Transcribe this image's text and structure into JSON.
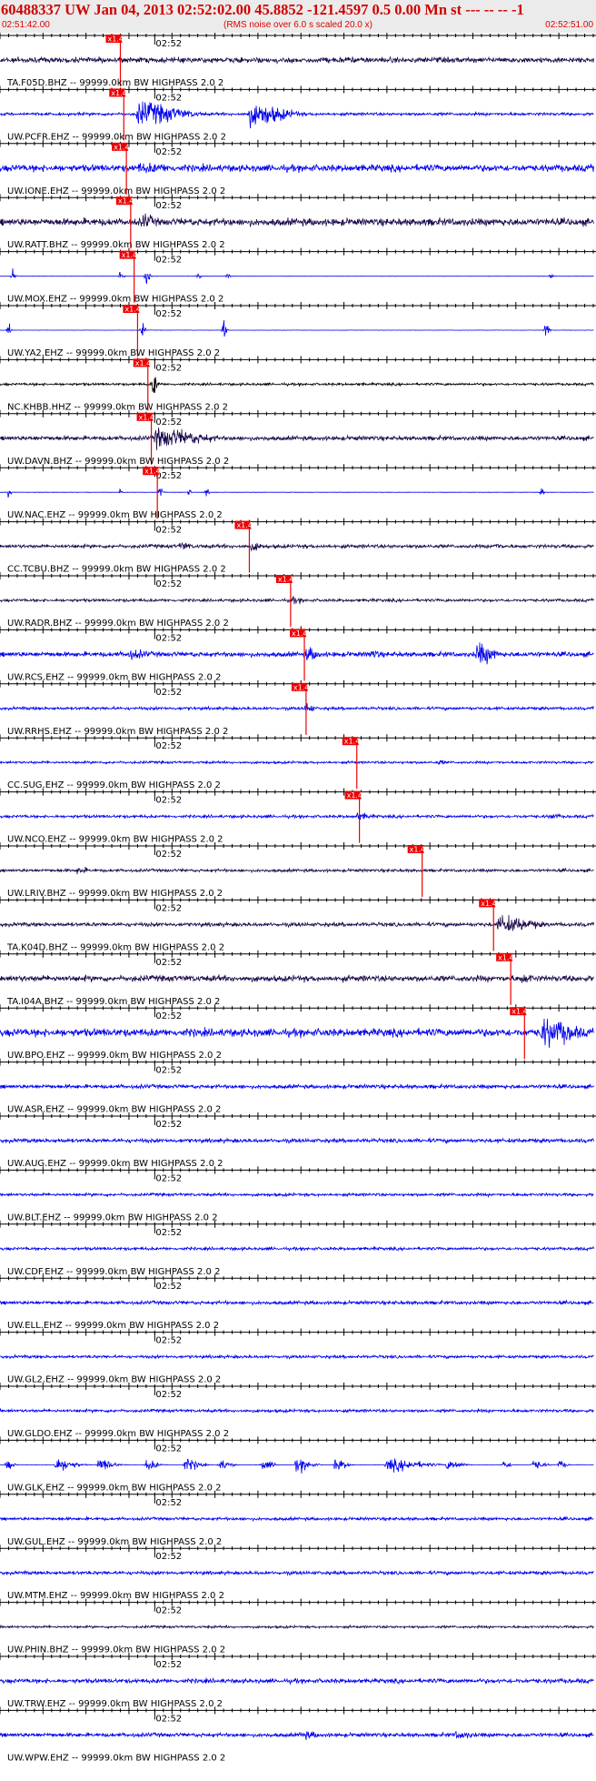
{
  "header": {
    "title": "60488337 UW Jan 04, 2013 02:52:02.00   45.8852 -121.4597  0.5 0.00 Mn st --- -- --   -1",
    "start_time": "02:51:42.00",
    "note": "(RMS noise over 6.0 s scaled 20.0 x)",
    "end_time": "02:52:51.00"
  },
  "chart_data": {
    "type": "line",
    "title": "60488337 UW Jan 04, 2013 02:52:02.00   45.8852 -121.4597  0.5 0.00 Mn st --- -- --   -1",
    "x_range_seconds": [
      0,
      69
    ],
    "minute_marker_label": "02:52",
    "minute_marker_second": 18,
    "pick_label": "x1.4",
    "colors": {
      "dark_trace": "#1c0a4c",
      "blue_trace": "#0000ee",
      "black_trace": "#000000",
      "pick": "#ee0000"
    },
    "traces": [
      {
        "label": "TA.F05D.BHZ -- 99999.0km BW  HIGHPASS  2.0  2",
        "color": "dark",
        "amp": 0.22,
        "pick_s": 14.0,
        "bursts": [
          [
            40,
            2.5,
            0.3
          ],
          [
            44,
            3,
            0.25
          ]
        ]
      },
      {
        "label": "UW.PCFR.EHZ -- 99999.0km BW  HIGHPASS  2.0  2",
        "color": "blue",
        "amp": 0.12,
        "pick_s": 14.4,
        "bursts": [
          [
            16,
            6,
            1.0
          ],
          [
            29,
            5,
            1.0
          ]
        ]
      },
      {
        "label": "UW.IONE.EHZ -- 99999.0km BW  HIGHPASS  2.0  2",
        "color": "blue",
        "amp": 0.28,
        "pick_s": 14.7,
        "bursts": [
          [
            16,
            8,
            0.45
          ]
        ]
      },
      {
        "label": "UW.RATT.BHZ -- 99999.0km BW  HIGHPASS  2.0  2",
        "color": "dark",
        "amp": 0.3,
        "pick_s": 15.2,
        "bursts": [
          [
            16.5,
            2,
            0.7
          ],
          [
            58,
            2,
            0.35
          ]
        ]
      },
      {
        "label": "UW.MOX.EHZ -- 99999.0km BW  HIGHPASS  2.0  2",
        "color": "blue",
        "amp": 0.015,
        "pick_s": 15.6,
        "bursts": [
          [
            1.5,
            0.3,
            0.5
          ],
          [
            14,
            0.4,
            0.5
          ],
          [
            17,
            0.5,
            0.55
          ],
          [
            23,
            0.3,
            0.3
          ],
          [
            26.5,
            0.3,
            0.35
          ],
          [
            64,
            0.4,
            0.3
          ]
        ]
      },
      {
        "label": "UW.YA2.EHZ -- 99999.0km BW  HIGHPASS  2.0  2",
        "color": "blue",
        "amp": 0.015,
        "pick_s": 16.0,
        "bursts": [
          [
            1,
            0.3,
            0.6
          ],
          [
            16.5,
            0.4,
            0.6
          ],
          [
            26,
            0.4,
            0.7
          ],
          [
            63.5,
            0.4,
            0.9
          ]
        ]
      },
      {
        "label": "NC.KHBB.HHZ -- 99999.0km BW  HIGHPASS  2.0  2",
        "color": "black",
        "amp": 0.1,
        "pick_s": 17.2,
        "bursts": [
          [
            17.8,
            0.6,
            1.0
          ]
        ]
      },
      {
        "label": "UW.DAVN.BHZ -- 99999.0km BW  HIGHPASS  2.0  2",
        "color": "dark",
        "amp": 0.18,
        "pick_s": 17.6,
        "bursts": [
          [
            18,
            7,
            0.85
          ]
        ]
      },
      {
        "label": "UW.NAC.EHZ -- 99999.0km BW  HIGHPASS  2.0  2",
        "color": "blue",
        "amp": 0.015,
        "pick_s": 18.3,
        "bursts": [
          [
            1,
            0.3,
            0.4
          ],
          [
            14,
            0.4,
            0.3
          ],
          [
            18.6,
            0.4,
            0.5
          ],
          [
            22,
            0.3,
            0.3
          ],
          [
            24,
            0.3,
            0.35
          ],
          [
            63,
            0.3,
            0.3
          ]
        ]
      },
      {
        "label": "CC.TCBU.BHZ -- 99999.0km BW  HIGHPASS  2.0  2",
        "color": "dark",
        "amp": 0.15,
        "pick_s": 29.0,
        "bursts": [
          [
            21,
            1.5,
            0.4
          ],
          [
            29.3,
            1.5,
            0.45
          ],
          [
            57.5,
            1,
            0.4
          ]
        ]
      },
      {
        "label": "UW.RADR.BHZ -- 99999.0km BW  HIGHPASS  2.0  2",
        "color": "dark",
        "amp": 0.12,
        "pick_s": 33.8,
        "bursts": [
          [
            33.8,
            2,
            0.3
          ]
        ]
      },
      {
        "label": "UW.RCS.EHZ -- 99999.0km BW  HIGHPASS  2.0  2",
        "color": "blue",
        "amp": 0.2,
        "pick_s": 35.4,
        "bursts": [
          [
            15,
            3,
            0.45
          ],
          [
            35.6,
            2,
            0.6
          ],
          [
            43,
            2,
            0.4
          ],
          [
            55.5,
            2.5,
            0.95
          ]
        ]
      },
      {
        "label": "UW.RRHS.EHZ -- 99999.0km BW  HIGHPASS  2.0  2",
        "color": "blue",
        "amp": 0.12,
        "pick_s": 35.6,
        "bursts": [
          [
            35.6,
            1,
            0.5
          ]
        ]
      },
      {
        "label": "CC.SUG.EHZ -- 99999.0km BW  HIGHPASS  2.0  2",
        "color": "blue",
        "amp": 0.1,
        "pick_s": 41.5,
        "bursts": [
          [
            51,
            1.5,
            0.2
          ]
        ]
      },
      {
        "label": "UW.NCO.EHZ -- 99999.0km BW  HIGHPASS  2.0  2",
        "color": "blue",
        "amp": 0.12,
        "pick_s": 41.8,
        "bursts": [
          [
            41.5,
            2,
            0.35
          ],
          [
            64,
            1.5,
            0.3
          ]
        ]
      },
      {
        "label": "UW.LRIV.BHZ -- 99999.0km BW  HIGHPASS  2.0  2",
        "color": "dark",
        "amp": 0.12,
        "pick_s": 49.1,
        "bursts": [
          [
            9,
            1.5,
            0.35
          ]
        ]
      },
      {
        "label": "TA.K04D.BHZ -- 99999.0km BW  HIGHPASS  2.0  2",
        "color": "dark",
        "amp": 0.16,
        "pick_s": 57.4,
        "bursts": [
          [
            58,
            5,
            0.75
          ]
        ]
      },
      {
        "label": "TA.I04A.BHZ -- 99999.0km BW  HIGHPASS  2.0  2",
        "color": "dark",
        "amp": 0.25,
        "pick_s": 59.4,
        "bursts": [
          [
            60.5,
            3,
            0.45
          ]
        ]
      },
      {
        "label": "UW.BPO.EHZ -- 99999.0km BW  HIGHPASS  2.0  2",
        "color": "blue",
        "amp": 0.32,
        "pick_s": 61.0,
        "bursts": [
          [
            63,
            5,
            1.2
          ]
        ]
      },
      {
        "label": "UW.ASR.EHZ -- 99999.0km BW  HIGHPASS  2.0  2",
        "color": "blue",
        "amp": 0.16,
        "pick_s": null,
        "bursts": []
      },
      {
        "label": "UW.AUG.EHZ -- 99999.0km BW  HIGHPASS  2.0  2",
        "color": "blue",
        "amp": 0.16,
        "pick_s": null,
        "bursts": []
      },
      {
        "label": "UW.BLT.EHZ -- 99999.0km BW  HIGHPASS  2.0  2",
        "color": "blue",
        "amp": 0.12,
        "pick_s": null,
        "bursts": []
      },
      {
        "label": "UW.CDF.EHZ -- 99999.0km BW  HIGHPASS  2.0  2",
        "color": "blue",
        "amp": 0.12,
        "pick_s": null,
        "bursts": []
      },
      {
        "label": "UW.ELL.EHZ -- 99999.0km BW  HIGHPASS  2.0  2",
        "color": "blue",
        "amp": 0.14,
        "pick_s": null,
        "bursts": []
      },
      {
        "label": "UW.GL2.EHZ -- 99999.0km BW  HIGHPASS  2.0  2",
        "color": "blue",
        "amp": 0.12,
        "pick_s": null,
        "bursts": []
      },
      {
        "label": "UW.GLDO.EHZ -- 99999.0km BW  HIGHPASS  2.0  2",
        "color": "blue",
        "amp": 0.12,
        "pick_s": null,
        "bursts": []
      },
      {
        "label": "UW.GLK.EHZ -- 99999.0km BW  HIGHPASS  2.0  2",
        "color": "blue",
        "amp": 0.015,
        "pick_s": null,
        "bursts": [
          [
            0.7,
            1,
            0.4
          ],
          [
            6.5,
            2.5,
            0.55
          ],
          [
            11.5,
            2,
            0.5
          ],
          [
            17,
            1.5,
            0.45
          ],
          [
            21.5,
            2,
            0.5
          ],
          [
            25.5,
            1.5,
            0.4
          ],
          [
            30.5,
            1.5,
            0.4
          ],
          [
            34.5,
            2,
            0.55
          ],
          [
            39,
            1.5,
            0.5
          ],
          [
            45,
            5,
            0.5
          ],
          [
            52,
            2,
            0.4
          ],
          [
            58.5,
            1,
            0.35
          ],
          [
            62,
            1.5,
            0.4
          ],
          [
            65,
            1,
            0.35
          ]
        ]
      },
      {
        "label": "UW.GUL.EHZ -- 99999.0km BW  HIGHPASS  2.0  2",
        "color": "blue",
        "amp": 0.12,
        "pick_s": null,
        "bursts": []
      },
      {
        "label": "UW.MTM.EHZ -- 99999.0km BW  HIGHPASS  2.0  2",
        "color": "blue",
        "amp": 0.14,
        "pick_s": null,
        "bursts": []
      },
      {
        "label": "UW.PHIN.BHZ -- 99999.0km BW  HIGHPASS  2.0  2",
        "color": "dark",
        "amp": 0.1,
        "pick_s": null,
        "bursts": []
      },
      {
        "label": "UW.TRW.EHZ -- 99999.0km BW  HIGHPASS  2.0  2",
        "color": "blue",
        "amp": 0.18,
        "pick_s": null,
        "bursts": []
      },
      {
        "label": "UW.WPW.EHZ -- 99999.0km BW  HIGHPASS  2.0  2",
        "color": "blue",
        "amp": 0.16,
        "pick_s": null,
        "bursts": [
          [
            35,
            3,
            0.35
          ],
          [
            53,
            3,
            0.35
          ]
        ]
      }
    ]
  }
}
